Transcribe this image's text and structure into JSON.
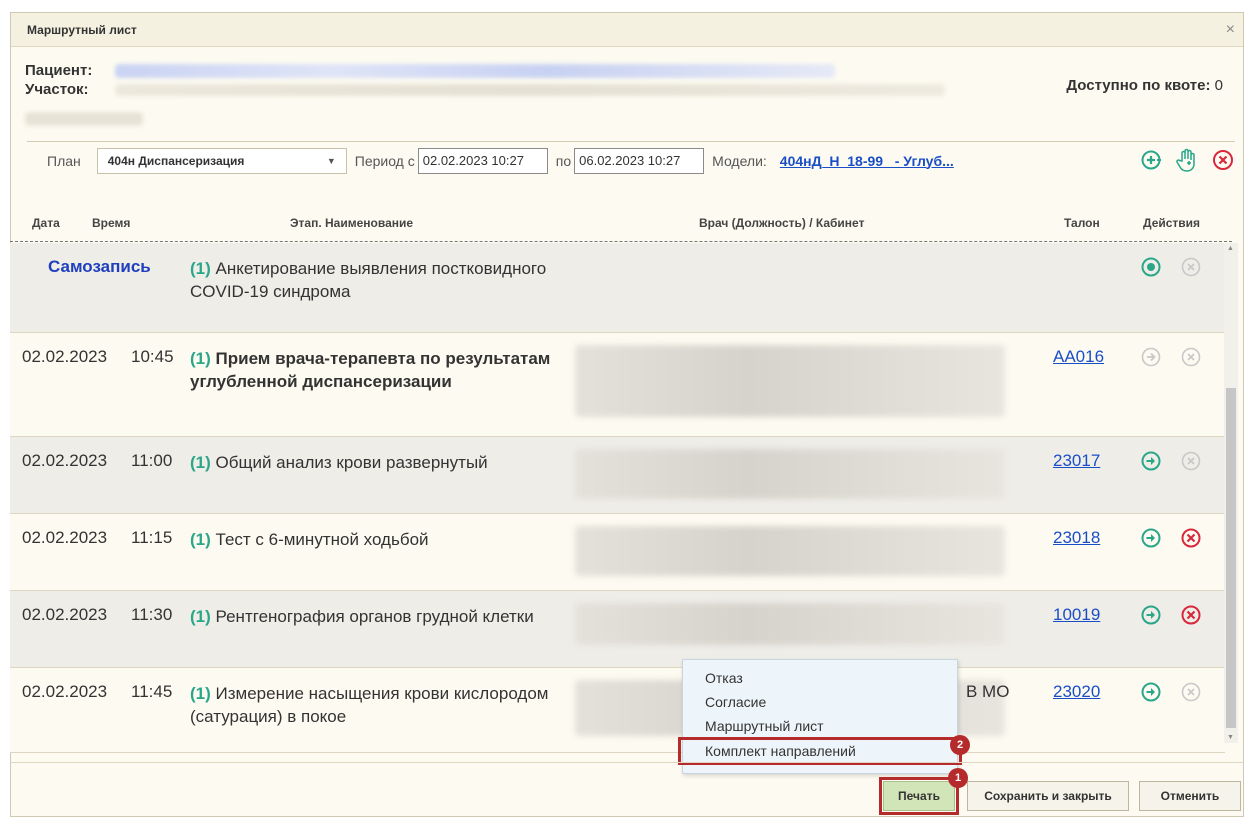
{
  "dialog": {
    "title": "Маршрутный лист",
    "close_icon": "×"
  },
  "patient": {
    "patient_label": "Пациент:",
    "area_label": "Участок:",
    "quota_label": "Доступно по квоте:",
    "quota_value": "0"
  },
  "toolbar": {
    "plan_label": "План",
    "plan_value": "404н Диспансеризация",
    "period_label": "Период с",
    "period_from": "02.02.2023 10:27",
    "period_to_label": "по",
    "period_to": "06.02.2023 10:27",
    "models_label": "Модели:",
    "models_link": "404нД_Н_18-99_ - Углуб...",
    "icons": [
      "add-circle-icon",
      "hand-icon",
      "cancel-circle-icon"
    ]
  },
  "table": {
    "headers": {
      "date": "Дата",
      "time": "Время",
      "name": "Этап. Наименование",
      "doctor": "Врач (Должность) / Кабинет",
      "talon": "Талон",
      "actions": "Действия"
    },
    "rows": [
      {
        "self": "Самозапись",
        "num": "(1)",
        "name": "Анкетирование выявления постковидного COVID-19 синдрома",
        "talon": "",
        "act1": "record-active",
        "act2": "cancel-disabled"
      },
      {
        "date": "02.02.2023",
        "time": "10:45",
        "num": "(1)",
        "name": "Прием врача-терапевта по результатам углубленной диспансеризации",
        "talon": "АА016",
        "act1": "arrow-disabled",
        "act2": "cancel-disabled"
      },
      {
        "date": "02.02.2023",
        "time": "11:00",
        "num": "(1)",
        "name": "Общий анализ крови развернутый",
        "talon": "23017",
        "act1": "arrow-active",
        "act2": "cancel-disabled"
      },
      {
        "date": "02.02.2023",
        "time": "11:15",
        "num": "(1)",
        "name": "Тест с 6-минутной ходьбой",
        "talon": "23018",
        "act1": "arrow-active",
        "act2": "cancel-active"
      },
      {
        "date": "02.02.2023",
        "time": "11:30",
        "num": "(1)",
        "name": "Рентгенография органов грудной клетки",
        "talon": "10019",
        "act1": "arrow-active",
        "act2": "cancel-active"
      },
      {
        "date": "02.02.2023",
        "time": "11:45",
        "num": "(1)",
        "name": "Измерение насыщения крови кислородом (сатурация) в покое",
        "doctor_tail": "В МО",
        "talon": "23020",
        "act1": "arrow-active",
        "act2": "cancel-disabled"
      }
    ]
  },
  "print_menu": {
    "items": [
      "Отказ",
      "Согласие",
      "Маршрутный лист",
      "Комплект направлений"
    ]
  },
  "footer": {
    "print": "Печать",
    "save_close": "Сохранить и закрыть",
    "cancel": "Отменить"
  },
  "badges": {
    "one": "1",
    "two": "2"
  },
  "colors": {
    "accent_green": "#2aa689",
    "danger_red": "#d9283c",
    "link_blue": "#1a4ec7",
    "highlight_red": "#b52a2a"
  }
}
